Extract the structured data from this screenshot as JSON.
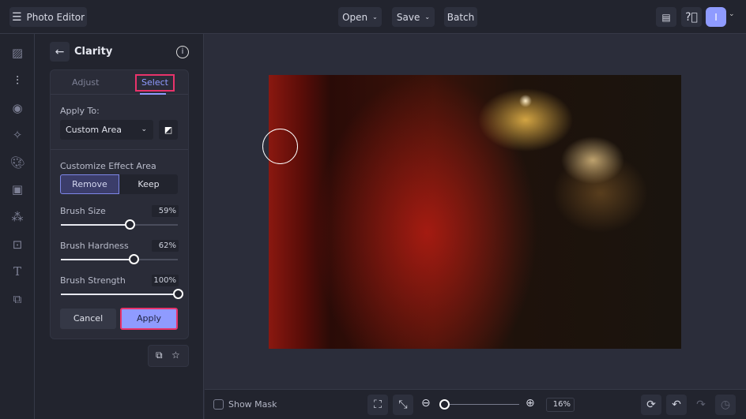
{
  "header": {
    "app_title": "Photo Editor",
    "open_label": "Open",
    "save_label": "Save",
    "batch_label": "Batch",
    "avatar_initial": "I"
  },
  "panel": {
    "title": "Clarity",
    "tabs": [
      {
        "label": "Adjust"
      },
      {
        "label": "Select"
      }
    ],
    "apply_to_label": "Apply To:",
    "apply_to_value": "Custom Area",
    "customize_label": "Customize Effect Area",
    "remove_label": "Remove",
    "keep_label": "Keep",
    "sliders": [
      {
        "label": "Brush Size",
        "value": "59%",
        "fraction": 0.59
      },
      {
        "label": "Brush Hardness",
        "value": "62%",
        "fraction": 0.62
      },
      {
        "label": "Brush Strength",
        "value": "100%",
        "fraction": 1.0
      }
    ],
    "cancel_label": "Cancel",
    "apply_label": "Apply"
  },
  "bottom": {
    "show_mask_label": "Show Mask",
    "zoom_value": "16%",
    "zoom_fraction": 0.03
  },
  "colors": {
    "accent": "#8f9bff",
    "highlight": "#e8336b",
    "background": "#22242e"
  }
}
